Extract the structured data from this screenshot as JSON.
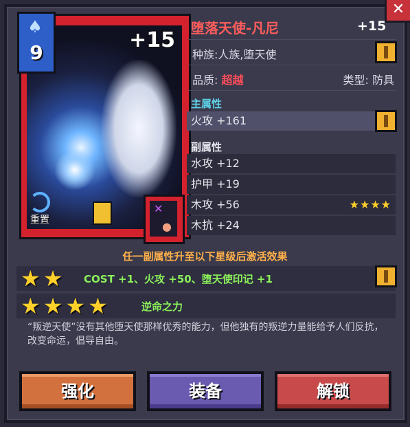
{
  "close": {
    "icon": "close-icon",
    "glyph": "✕"
  },
  "card": {
    "level": "9",
    "level_icon": "spade-icon",
    "enhance": "+15",
    "reset_label": "重置",
    "reset_icon": "refresh-icon",
    "lock_icon": "lock-icon",
    "type_icon": "armor-type-icon"
  },
  "item": {
    "name": "堕落天使-凡尼",
    "enhance": "+15",
    "race": "种族:人族,堕天使",
    "quality_label": "品质: ",
    "quality_value": "超越",
    "type": "类型: 防具"
  },
  "main_attr": {
    "title": "主属性",
    "items": [
      {
        "text": "火攻 +161"
      }
    ]
  },
  "sub_attr": {
    "title": "副属性",
    "items": [
      {
        "text": "水攻 +12",
        "stars": ""
      },
      {
        "text": "护甲 +19",
        "stars": ""
      },
      {
        "text": "木攻 +56",
        "stars": "★★★★"
      },
      {
        "text": "木抗 +24",
        "stars": ""
      }
    ]
  },
  "bonus": {
    "header": "任一副属性升至以下星级后激活效果",
    "tiers": [
      {
        "stars": "★★",
        "text": "COST +1、火攻 +50、堕天使印记 +1"
      },
      {
        "stars": "★★★★",
        "text": "逆命之力"
      }
    ]
  },
  "description": "“叛逆天使”没有其他堕天使那样优秀的能力，但他独有的叛逆力量能给予人们反抗，改变命运，倡导自由。",
  "buttons": {
    "strengthen": "强化",
    "equip": "装备",
    "unlock": "解锁"
  },
  "colors": {
    "card_frame": "#d3222e",
    "name": "#ff5c5c",
    "quality": "#ff4d5a",
    "main_attr_title": "#5fd3e8",
    "bonus_header": "#ffb04a",
    "bonus_text": "#8cf05a",
    "star": "#ffcf2a"
  }
}
